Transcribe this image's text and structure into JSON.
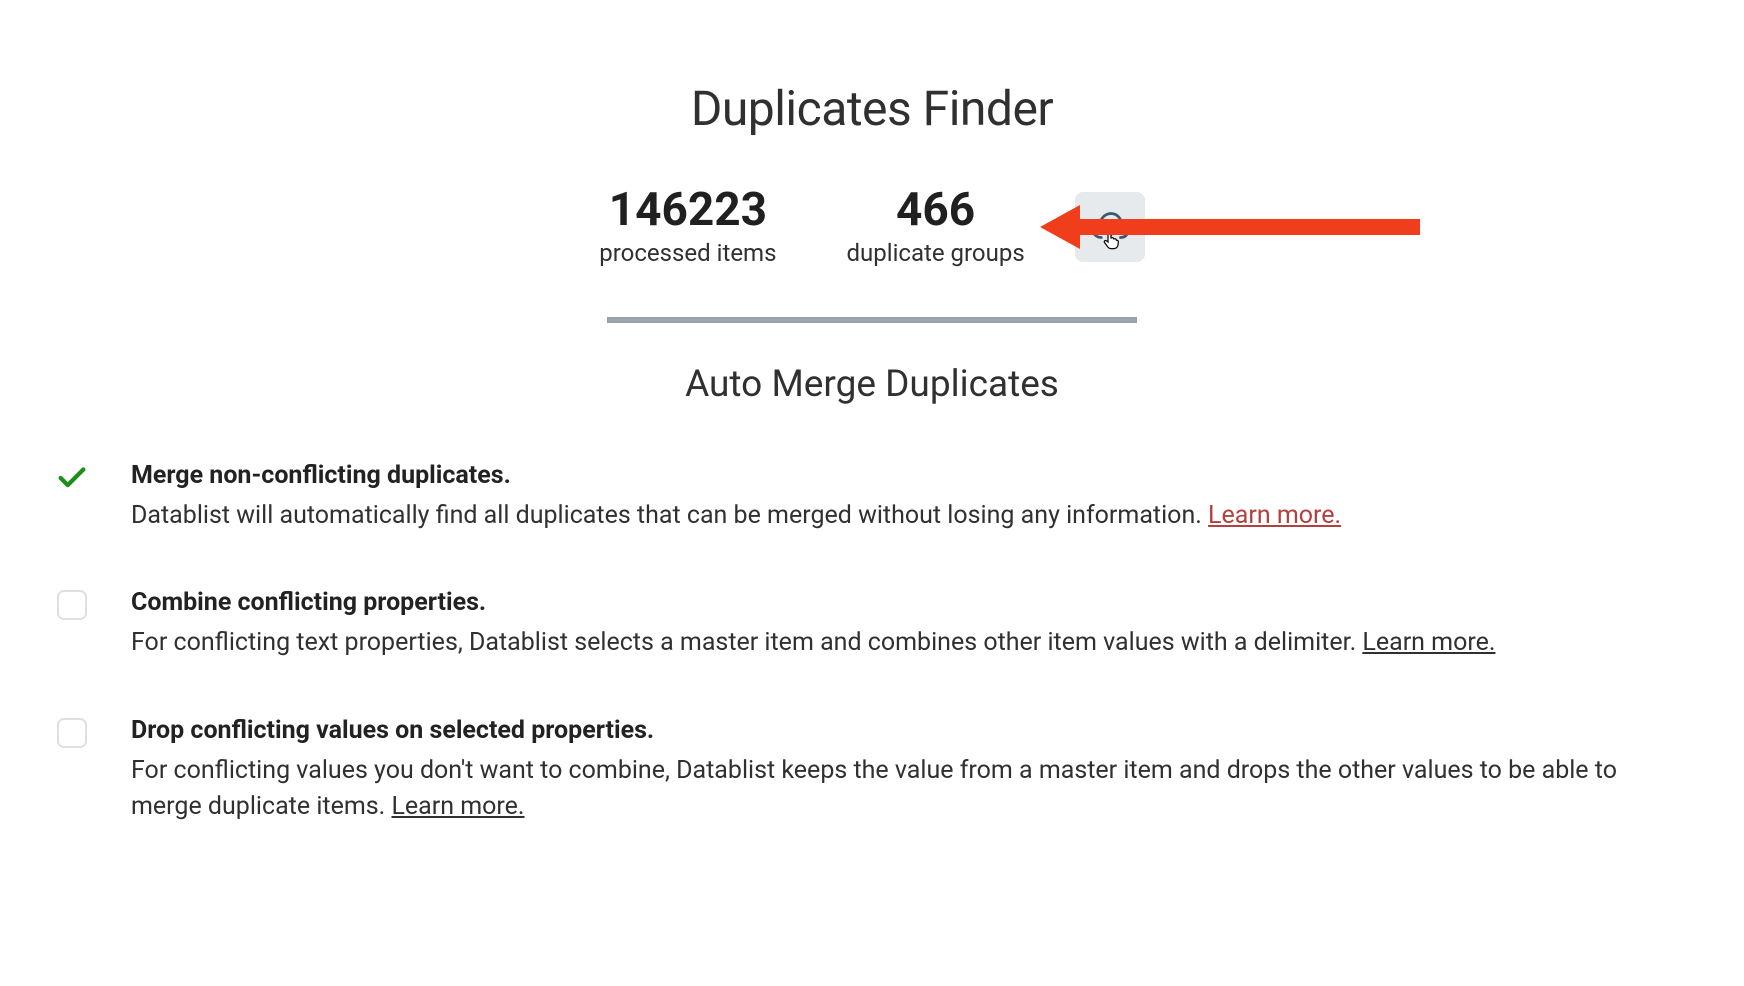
{
  "title": "Duplicates Finder",
  "stats": {
    "processed": {
      "value": "146223",
      "label": "processed items"
    },
    "groups": {
      "value": "466",
      "label": "duplicate groups"
    }
  },
  "subtitle": "Auto Merge Duplicates",
  "options": [
    {
      "checked": true,
      "title": "Merge non-conflicting duplicates.",
      "desc": "Datablist will automatically find all duplicates that can be merged without losing any information. ",
      "link": "Learn more.",
      "link_style": "red"
    },
    {
      "checked": false,
      "title": "Combine conflicting properties.",
      "desc": "For conflicting text properties, Datablist selects a master item and combines other item values with a delimiter. ",
      "link": "Learn more.",
      "link_style": "dark"
    },
    {
      "checked": false,
      "title": "Drop conflicting values on selected properties.",
      "desc": "For conflicting values you don't want to combine, Datablist keeps the value from a master item and drops the other values to be able to merge duplicate items. ",
      "link": "Learn more.",
      "link_style": "dark"
    }
  ]
}
